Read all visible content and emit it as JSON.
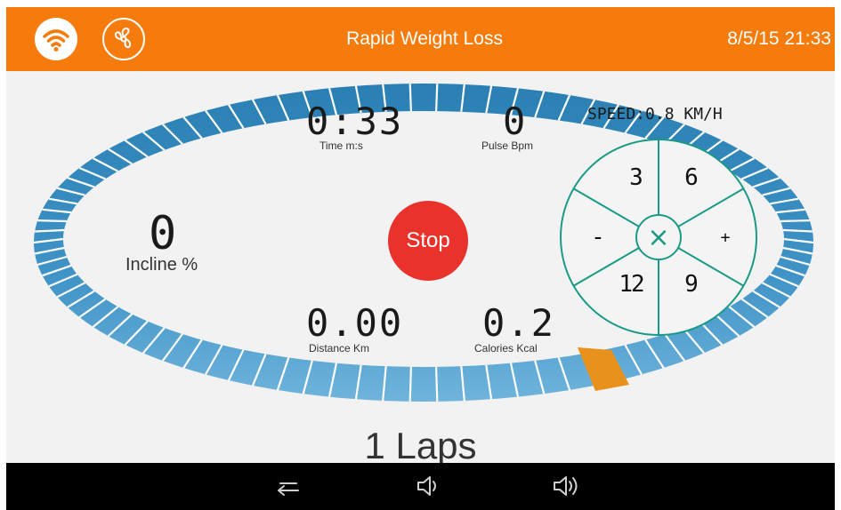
{
  "header": {
    "title": "Rapid Weight Loss",
    "clock": "8/5/15 21:33",
    "icons": [
      "wifi-icon",
      "fan-icon"
    ]
  },
  "metrics": {
    "time_value": "0:33",
    "time_label": "Time m:s",
    "pulse_value": "0",
    "pulse_label": "Pulse Bpm",
    "incline_value": "0",
    "incline_label": "Incline %",
    "distance_value": "0.00",
    "distance_label": "Distance Km",
    "calories_value": "0.2",
    "calories_label": "Calories Kcal",
    "speed_text": "SPEED:0.8 KM/H"
  },
  "controls": {
    "stop_label": "Stop",
    "speed_dial": {
      "key_3": "3",
      "key_6": "6",
      "key_minus": "-",
      "key_plus": "+",
      "key_12": "12",
      "key_9": "9",
      "center": "×"
    }
  },
  "track": {
    "laps_text": "1 Laps",
    "progress_color": "#e8921c",
    "track_color": "#1c7ab8"
  },
  "navbar": {
    "icons": [
      "back-icon",
      "volume-down-icon",
      "volume-up-icon"
    ]
  },
  "colors": {
    "accent": "#f57c0c",
    "stop": "#e8322b",
    "dial": "#1a9a86"
  }
}
